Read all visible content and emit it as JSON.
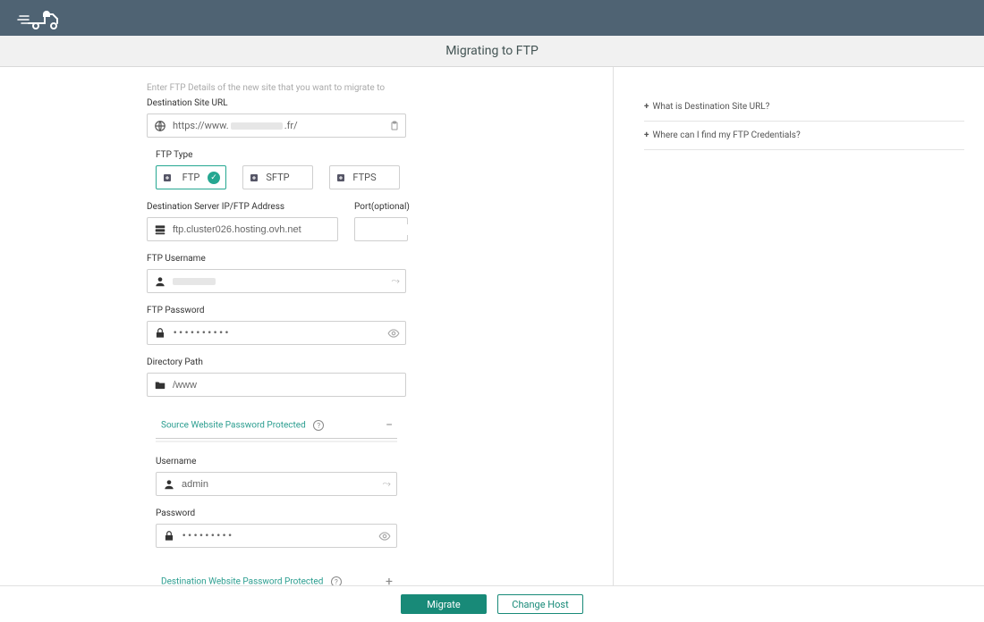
{
  "page_title": "Migrating to FTP",
  "intro": "Enter FTP Details of the new site that you want to migrate to",
  "labels": {
    "dest_url": "Destination Site URL",
    "ftp_type": "FTP Type",
    "dest_server": "Destination Server IP/FTP Address",
    "port": "Port(optional)",
    "ftp_user": "FTP Username",
    "ftp_pass": "FTP Password",
    "dir_path": "Directory Path",
    "src_protected": "Source Website Password Protected",
    "dest_protected": "Destination Website Password Protected",
    "username": "Username",
    "password": "Password"
  },
  "ftp_types": {
    "a": "FTP",
    "b": "SFTP",
    "c": "FTPS"
  },
  "values": {
    "dest_url_prefix": "https://www.",
    "dest_url_suffix": ".fr/",
    "dest_server": "ftp.cluster026.hosting.ovh.net",
    "port": "",
    "ftp_user_redacted": true,
    "ftp_pass": "••••••••••",
    "dir_path": "/www",
    "src_user": "admin",
    "src_pass": "•••••••••"
  },
  "faq": {
    "q1": "What is Destination Site URL?",
    "q2": "Where can I find my FTP Credentials?"
  },
  "buttons": {
    "migrate": "Migrate",
    "change_host": "Change Host"
  },
  "accordion": {
    "open_toggle": "−",
    "closed_toggle": "+"
  }
}
